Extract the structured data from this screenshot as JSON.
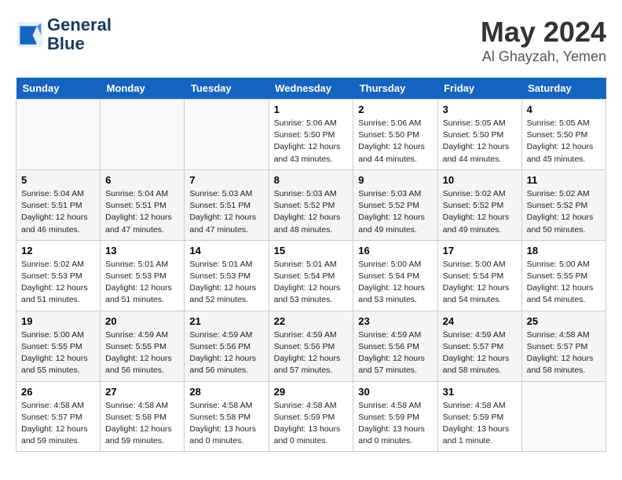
{
  "header": {
    "logo_line1": "General",
    "logo_line2": "Blue",
    "month_year": "May 2024",
    "location": "Al Ghayzah, Yemen"
  },
  "days_of_week": [
    "Sunday",
    "Monday",
    "Tuesday",
    "Wednesday",
    "Thursday",
    "Friday",
    "Saturday"
  ],
  "weeks": [
    [
      {
        "day": "",
        "info": ""
      },
      {
        "day": "",
        "info": ""
      },
      {
        "day": "",
        "info": ""
      },
      {
        "day": "1",
        "info": "Sunrise: 5:06 AM\nSunset: 5:50 PM\nDaylight: 12 hours\nand 43 minutes."
      },
      {
        "day": "2",
        "info": "Sunrise: 5:06 AM\nSunset: 5:50 PM\nDaylight: 12 hours\nand 44 minutes."
      },
      {
        "day": "3",
        "info": "Sunrise: 5:05 AM\nSunset: 5:50 PM\nDaylight: 12 hours\nand 44 minutes."
      },
      {
        "day": "4",
        "info": "Sunrise: 5:05 AM\nSunset: 5:50 PM\nDaylight: 12 hours\nand 45 minutes."
      }
    ],
    [
      {
        "day": "5",
        "info": "Sunrise: 5:04 AM\nSunset: 5:51 PM\nDaylight: 12 hours\nand 46 minutes."
      },
      {
        "day": "6",
        "info": "Sunrise: 5:04 AM\nSunset: 5:51 PM\nDaylight: 12 hours\nand 47 minutes."
      },
      {
        "day": "7",
        "info": "Sunrise: 5:03 AM\nSunset: 5:51 PM\nDaylight: 12 hours\nand 47 minutes."
      },
      {
        "day": "8",
        "info": "Sunrise: 5:03 AM\nSunset: 5:52 PM\nDaylight: 12 hours\nand 48 minutes."
      },
      {
        "day": "9",
        "info": "Sunrise: 5:03 AM\nSunset: 5:52 PM\nDaylight: 12 hours\nand 49 minutes."
      },
      {
        "day": "10",
        "info": "Sunrise: 5:02 AM\nSunset: 5:52 PM\nDaylight: 12 hours\nand 49 minutes."
      },
      {
        "day": "11",
        "info": "Sunrise: 5:02 AM\nSunset: 5:52 PM\nDaylight: 12 hours\nand 50 minutes."
      }
    ],
    [
      {
        "day": "12",
        "info": "Sunrise: 5:02 AM\nSunset: 5:53 PM\nDaylight: 12 hours\nand 51 minutes."
      },
      {
        "day": "13",
        "info": "Sunrise: 5:01 AM\nSunset: 5:53 PM\nDaylight: 12 hours\nand 51 minutes."
      },
      {
        "day": "14",
        "info": "Sunrise: 5:01 AM\nSunset: 5:53 PM\nDaylight: 12 hours\nand 52 minutes."
      },
      {
        "day": "15",
        "info": "Sunrise: 5:01 AM\nSunset: 5:54 PM\nDaylight: 12 hours\nand 53 minutes."
      },
      {
        "day": "16",
        "info": "Sunrise: 5:00 AM\nSunset: 5:54 PM\nDaylight: 12 hours\nand 53 minutes."
      },
      {
        "day": "17",
        "info": "Sunrise: 5:00 AM\nSunset: 5:54 PM\nDaylight: 12 hours\nand 54 minutes."
      },
      {
        "day": "18",
        "info": "Sunrise: 5:00 AM\nSunset: 5:55 PM\nDaylight: 12 hours\nand 54 minutes."
      }
    ],
    [
      {
        "day": "19",
        "info": "Sunrise: 5:00 AM\nSunset: 5:55 PM\nDaylight: 12 hours\nand 55 minutes."
      },
      {
        "day": "20",
        "info": "Sunrise: 4:59 AM\nSunset: 5:55 PM\nDaylight: 12 hours\nand 56 minutes."
      },
      {
        "day": "21",
        "info": "Sunrise: 4:59 AM\nSunset: 5:56 PM\nDaylight: 12 hours\nand 56 minutes."
      },
      {
        "day": "22",
        "info": "Sunrise: 4:59 AM\nSunset: 5:56 PM\nDaylight: 12 hours\nand 57 minutes."
      },
      {
        "day": "23",
        "info": "Sunrise: 4:59 AM\nSunset: 5:56 PM\nDaylight: 12 hours\nand 57 minutes."
      },
      {
        "day": "24",
        "info": "Sunrise: 4:59 AM\nSunset: 5:57 PM\nDaylight: 12 hours\nand 58 minutes."
      },
      {
        "day": "25",
        "info": "Sunrise: 4:58 AM\nSunset: 5:57 PM\nDaylight: 12 hours\nand 58 minutes."
      }
    ],
    [
      {
        "day": "26",
        "info": "Sunrise: 4:58 AM\nSunset: 5:57 PM\nDaylight: 12 hours\nand 59 minutes."
      },
      {
        "day": "27",
        "info": "Sunrise: 4:58 AM\nSunset: 5:58 PM\nDaylight: 12 hours\nand 59 minutes."
      },
      {
        "day": "28",
        "info": "Sunrise: 4:58 AM\nSunset: 5:58 PM\nDaylight: 13 hours\nand 0 minutes."
      },
      {
        "day": "29",
        "info": "Sunrise: 4:58 AM\nSunset: 5:59 PM\nDaylight: 13 hours\nand 0 minutes."
      },
      {
        "day": "30",
        "info": "Sunrise: 4:58 AM\nSunset: 5:59 PM\nDaylight: 13 hours\nand 0 minutes."
      },
      {
        "day": "31",
        "info": "Sunrise: 4:58 AM\nSunset: 5:59 PM\nDaylight: 13 hours\nand 1 minute."
      },
      {
        "day": "",
        "info": ""
      }
    ]
  ]
}
